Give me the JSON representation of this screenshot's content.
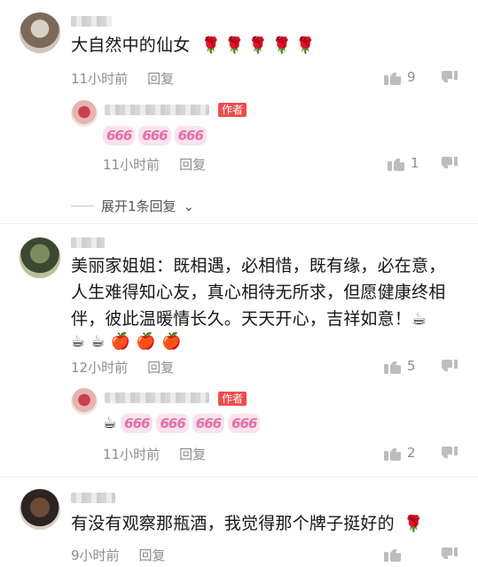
{
  "comments": [
    {
      "text": "大自然中的仙女",
      "emojis": [
        "🌹",
        "🌹",
        "🌹",
        "🌹",
        "🌹"
      ],
      "time": "11小时前",
      "reply_label": "回复",
      "likes": "9",
      "reply": {
        "badge": "作者",
        "emojis": [
          "666",
          "666",
          "666"
        ],
        "time": "11小时前",
        "reply_label": "回复",
        "likes": "1"
      },
      "expand_label": "展开1条回复"
    },
    {
      "text_lines": [
        "美丽家姐姐：既相遇，必相惜，既有缘，必在意，",
        "人生难得知心友，真心相待无所求，但愿健康终相",
        "伴，彼此温暖情长久。天天开心，吉祥如意！☕"
      ],
      "emoji_line": [
        "☕",
        "☕",
        "🍎",
        "🍎",
        "🍎"
      ],
      "time": "12小时前",
      "reply_label": "回复",
      "likes": "5",
      "reply": {
        "badge": "作者",
        "emojis": [
          "☕",
          "666",
          "666",
          "666",
          "666"
        ],
        "time": "11小时前",
        "reply_label": "回复",
        "likes": "2"
      }
    },
    {
      "text": "有没有观察那瓶酒，我觉得那个牌子挺好的",
      "emojis": [
        "🌹"
      ],
      "time": "9小时前",
      "reply_label": "回复"
    }
  ],
  "icons": {
    "like": "thumbs-up-icon",
    "dislike": "thumbs-down-icon",
    "chevron": "chevron-down-icon"
  },
  "colors": {
    "badge": "#f04c4c",
    "meta": "#8d8d8d"
  }
}
